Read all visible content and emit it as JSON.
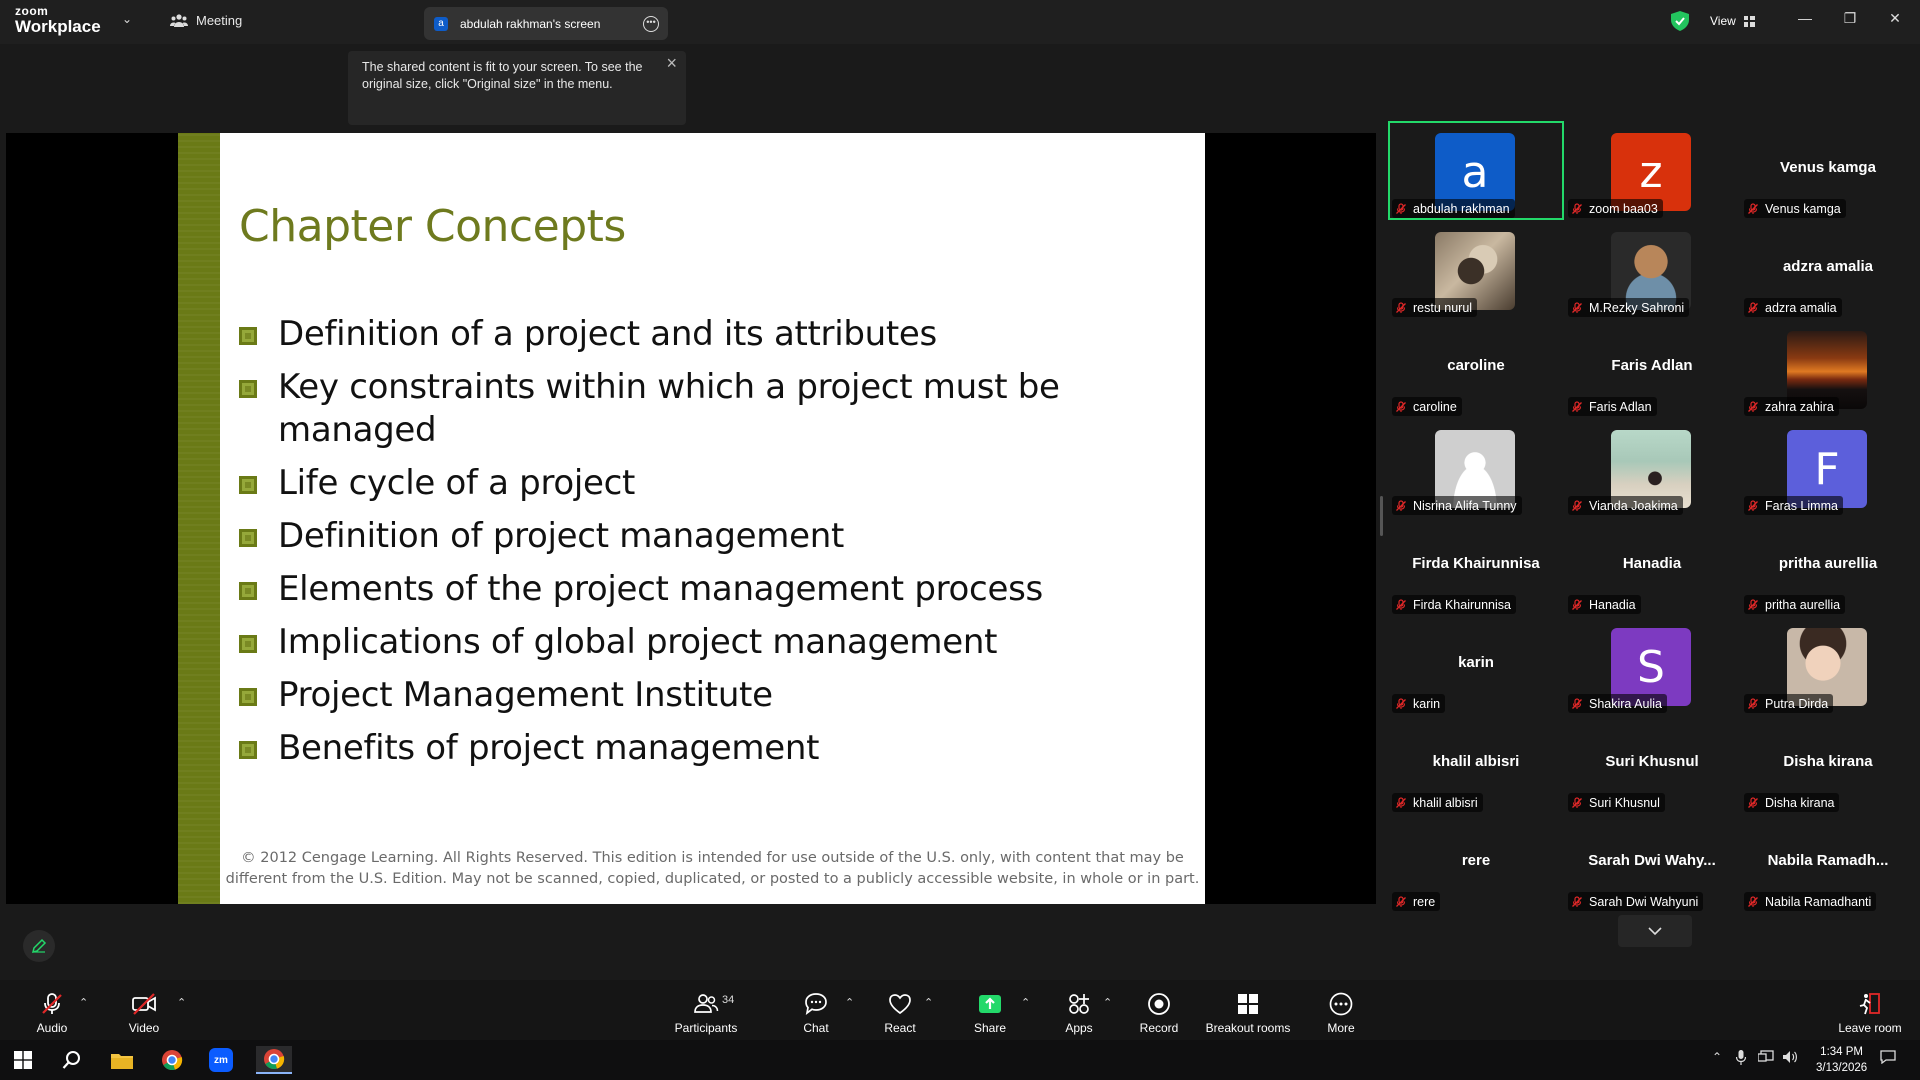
{
  "app": {
    "brand_line1": "zoom",
    "brand_line2": "Workplace"
  },
  "tabs": {
    "meeting": "Meeting",
    "screen_avatar": "a",
    "screen": "abdulah rakhman's screen"
  },
  "header": {
    "view_label": "View"
  },
  "tooltip": {
    "text": "The shared content is fit to your screen. To see the original size, click \"Original size\" in the menu."
  },
  "slide": {
    "title": "Chapter Concepts",
    "bullets": [
      "Definition of a project and its attributes",
      "Key constraints within which a project must be managed",
      "Life cycle of a project",
      "Definition of project management",
      "Elements of the project management process",
      "Implications of global project management",
      "Project Management Institute",
      "Benefits of project management"
    ],
    "footer": "© 2012 Cengage Learning. All Rights Reserved. This edition is intended for use outside of the U.S. only, with content that may be different from the U.S. Edition. May not be scanned, copied, duplicated, or posted to a publicly accessible website, in whole or in part."
  },
  "participants": [
    {
      "name": "abdulah rakhman",
      "kind": "letter",
      "letter": "a",
      "color": "#0e5cc8",
      "active": true
    },
    {
      "name": "zoom baa03",
      "kind": "letter",
      "letter": "z",
      "color": "#d8310c"
    },
    {
      "name": "Venus kamga",
      "kind": "name"
    },
    {
      "name": "restu nurul",
      "kind": "photo",
      "photo": "cat"
    },
    {
      "name": "M.Rezky Sahroni",
      "kind": "photo",
      "photo": "cartoon"
    },
    {
      "name": "adzra amalia",
      "kind": "name"
    },
    {
      "name": "caroline",
      "kind": "name"
    },
    {
      "name": "Faris Adlan",
      "kind": "name"
    },
    {
      "name": "zahra zahira",
      "kind": "photo",
      "photo": "sunset"
    },
    {
      "name": "Nisrina Alifa Tunny",
      "kind": "photo",
      "photo": "default"
    },
    {
      "name": "Vianda Joakima",
      "kind": "photo",
      "photo": "room"
    },
    {
      "name": "Faras Limma",
      "kind": "letter",
      "letter": "F",
      "color": "#5c5fdb"
    },
    {
      "name": "Firda Khairunnisa",
      "kind": "name"
    },
    {
      "name": "Hanadia",
      "kind": "name"
    },
    {
      "name": "pritha aurellia",
      "kind": "name"
    },
    {
      "name": "karin",
      "kind": "name"
    },
    {
      "name": "Shakira Aulia",
      "kind": "letter",
      "letter": "S",
      "color": "#7d3ac1"
    },
    {
      "name": "Putra Dirda",
      "kind": "photo",
      "photo": "baby"
    },
    {
      "name": "khalil albisri",
      "kind": "name"
    },
    {
      "name": "Suri Khusnul",
      "kind": "name"
    },
    {
      "name": "Disha kirana",
      "kind": "name"
    },
    {
      "name": "rere",
      "kind": "name"
    },
    {
      "name": "Sarah Dwi Wahyuni",
      "kind": "name",
      "display": "Sarah  Dwi  Wahy..."
    },
    {
      "name": "Nabila Ramadhanti",
      "kind": "name",
      "display": "Nabila  Ramadh..."
    }
  ],
  "toolbar": {
    "audio": "Audio",
    "video": "Video",
    "participants": "Participants",
    "participants_count": "34",
    "chat": "Chat",
    "react": "React",
    "share": "Share",
    "apps": "Apps",
    "record": "Record",
    "breakout": "Breakout rooms",
    "more": "More",
    "leave": "Leave room"
  },
  "taskbar": {
    "time": "1:34 PM",
    "date": "3/13/2026"
  },
  "colors": {
    "active_speaker": "#23d96a",
    "share_green": "#23d96a",
    "slide_accent": "#6a7a16",
    "mute_red": "#e02828"
  }
}
